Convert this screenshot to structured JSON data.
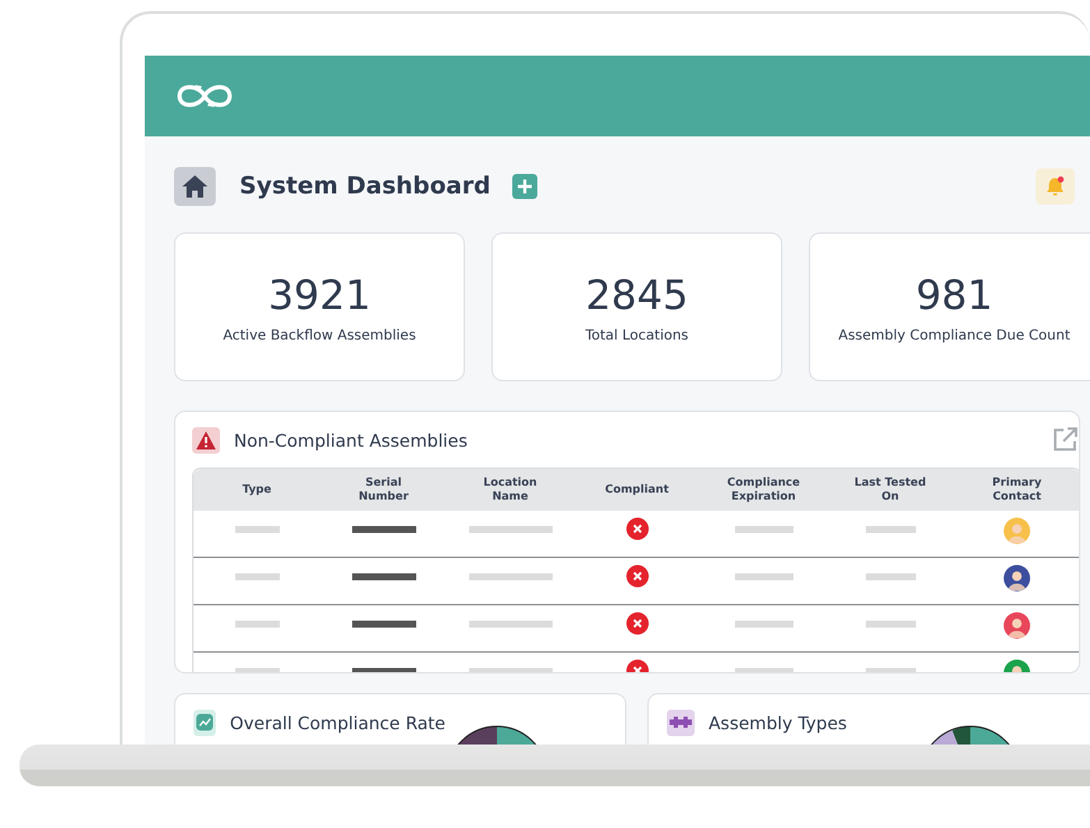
{
  "page": {
    "title": "System Dashboard",
    "notification": true
  },
  "stats": [
    {
      "value": "3921",
      "label": "Active Backflow Assemblies"
    },
    {
      "value": "2845",
      "label": "Total Locations"
    },
    {
      "value": "981",
      "label": "Assembly Compliance Due Count"
    }
  ],
  "noncompliant": {
    "title": "Non-Compliant Assemblies",
    "columns": [
      "Type",
      "Serial Number",
      "Location Name",
      "Compliant",
      "Compliance Expiration",
      "Last Tested On",
      "Primary Contact"
    ],
    "rows": [
      {
        "compliant": false,
        "color": "#f7c04a"
      },
      {
        "compliant": false,
        "color": "#3d4e9e"
      },
      {
        "compliant": false,
        "color": "#e8465a"
      },
      {
        "compliant": false,
        "color": "#1aa34a"
      }
    ]
  },
  "panels": [
    {
      "title": "Overall Compliance Rate",
      "kind": "trend"
    },
    {
      "title": "Assembly Types",
      "kind": "pipe"
    }
  ]
}
